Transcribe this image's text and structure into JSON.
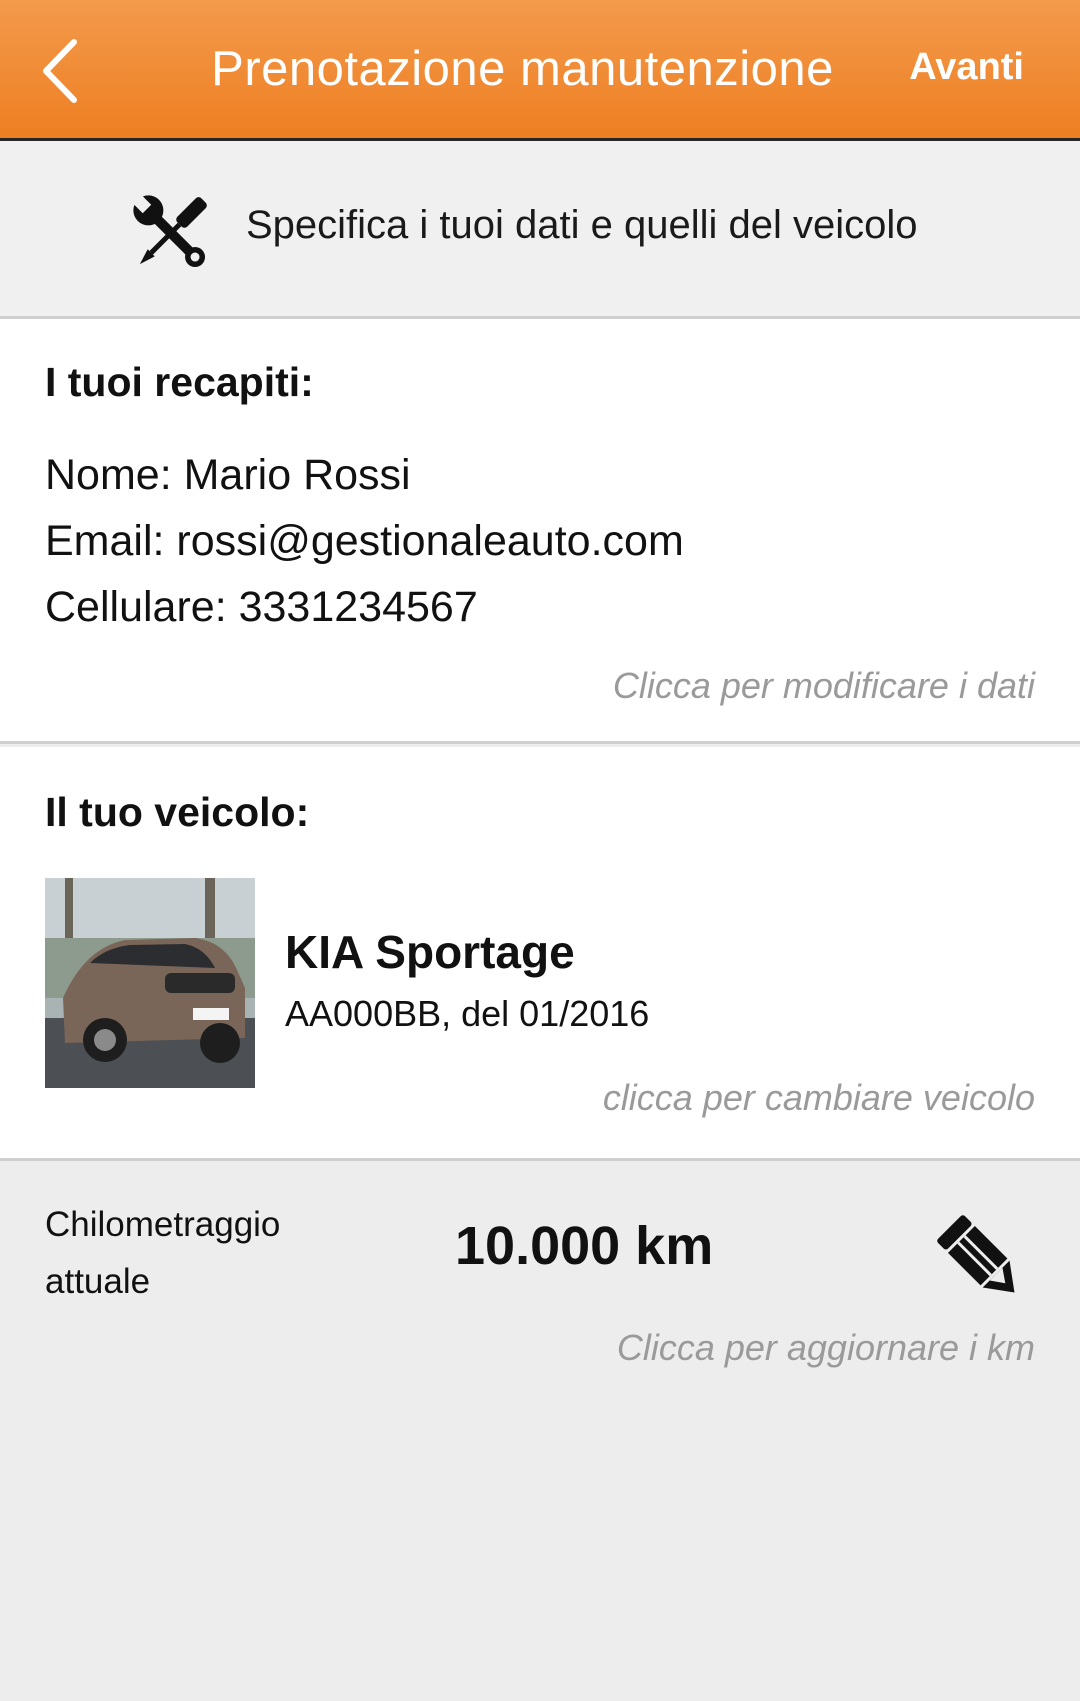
{
  "header": {
    "title": "Prenotazione manutenzione",
    "next_label": "Avanti",
    "back_icon": "chevron-left-icon"
  },
  "intro": {
    "icon": "wrench-screwdriver-icon",
    "text": "Specifica i tuoi dati e quelli del veicolo"
  },
  "contacts": {
    "title": "I tuoi recapiti:",
    "name": "Nome: Mario Rossi",
    "email": "Email: rossi@gestionaleauto.com",
    "phone": "Cellulare: 3331234567",
    "hint": "Clicca per modificare i dati"
  },
  "vehicle": {
    "title": "Il tuo veicolo:",
    "model": "KIA Sportage",
    "details": "AA000BB, del 01/2016",
    "hint": "clicca per cambiare veicolo"
  },
  "mileage": {
    "label_line1": "Chilometraggio",
    "label_line2": "attuale",
    "value": "10.000 km",
    "edit_icon": "pencil-icon",
    "hint": "Clicca per aggiornare i km"
  },
  "colors": {
    "header_top": "#f39a4c",
    "header_bottom": "#ee7f22",
    "background": "#ededed",
    "hint_text": "#9a9a9a"
  }
}
